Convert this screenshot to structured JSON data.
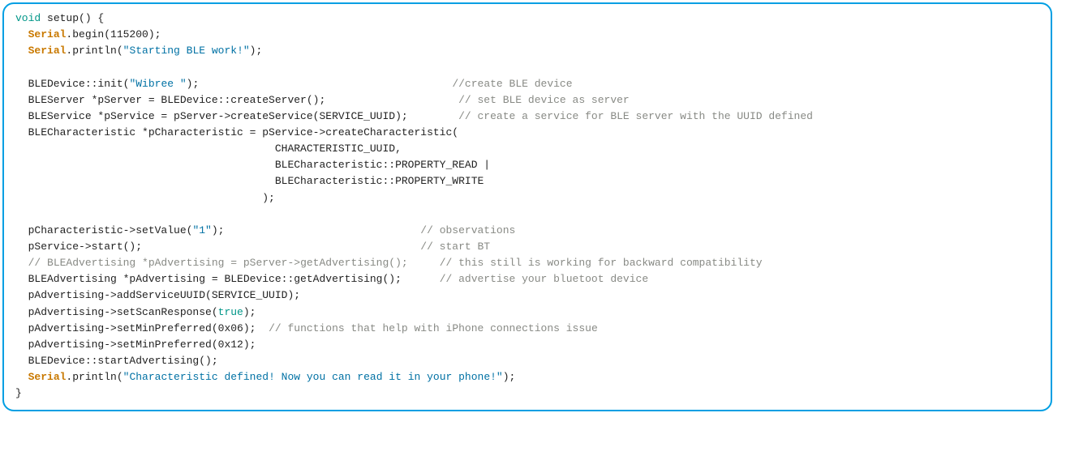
{
  "code": {
    "colors": {
      "border": "#009fe3",
      "keyword": "#009688",
      "type": "#c97900",
      "string": "#0071a4",
      "comment": "#888a85"
    },
    "tokens": [
      [
        [
          "kw",
          "void"
        ],
        [
          "plain",
          " setup"
        ],
        [
          "plain",
          "() {"
        ]
      ],
      [
        [
          "plain",
          "  "
        ],
        [
          "type",
          "Serial"
        ],
        [
          "plain",
          ".begin("
        ],
        [
          "plain",
          "115200"
        ],
        [
          "plain",
          ");"
        ]
      ],
      [
        [
          "plain",
          "  "
        ],
        [
          "type",
          "Serial"
        ],
        [
          "plain",
          ".println("
        ],
        [
          "str",
          "\"Starting BLE work!\""
        ],
        [
          "plain",
          ");"
        ]
      ],
      [
        [
          "plain",
          ""
        ]
      ],
      [
        [
          "plain",
          "  BLEDevice::init("
        ],
        [
          "str",
          "\"Wibree \""
        ],
        [
          "plain",
          ");                                        "
        ],
        [
          "com",
          "//create BLE device"
        ]
      ],
      [
        [
          "plain",
          "  BLEServer *pServer = BLEDevice::createServer();                     "
        ],
        [
          "com",
          "// set BLE device as server"
        ]
      ],
      [
        [
          "plain",
          "  BLEService *pService = pServer->createService(SERVICE_UUID);        "
        ],
        [
          "com",
          "// create a service for BLE server with the UUID defined"
        ]
      ],
      [
        [
          "plain",
          "  BLECharacteristic *pCharacteristic = pService->createCharacteristic("
        ]
      ],
      [
        [
          "plain",
          "                                         CHARACTERISTIC_UUID,"
        ]
      ],
      [
        [
          "plain",
          "                                         BLECharacteristic::PROPERTY_READ |"
        ]
      ],
      [
        [
          "plain",
          "                                         BLECharacteristic::PROPERTY_WRITE"
        ]
      ],
      [
        [
          "plain",
          "                                       );"
        ]
      ],
      [
        [
          "plain",
          ""
        ]
      ],
      [
        [
          "plain",
          "  pCharacteristic->setValue("
        ],
        [
          "str",
          "\"1\""
        ],
        [
          "plain",
          ");                               "
        ],
        [
          "com",
          "// observations"
        ]
      ],
      [
        [
          "plain",
          "  pService->start();                                            "
        ],
        [
          "com",
          "// start BT"
        ]
      ],
      [
        [
          "plain",
          "  "
        ],
        [
          "com",
          "// BLEAdvertising *pAdvertising = pServer->getAdvertising();     // this still is working for backward compatibility"
        ]
      ],
      [
        [
          "plain",
          "  BLEAdvertising *pAdvertising = BLEDevice::getAdvertising();      "
        ],
        [
          "com",
          "// advertise your bluetoot device"
        ]
      ],
      [
        [
          "plain",
          "  pAdvertising->addServiceUUID(SERVICE_UUID);"
        ]
      ],
      [
        [
          "plain",
          "  pAdvertising->setScanResponse("
        ],
        [
          "kw",
          "true"
        ],
        [
          "plain",
          ");"
        ]
      ],
      [
        [
          "plain",
          "  pAdvertising->setMinPreferred("
        ],
        [
          "plain",
          "0x06"
        ],
        [
          "plain",
          ");  "
        ],
        [
          "com",
          "// functions that help with iPhone connections issue"
        ]
      ],
      [
        [
          "plain",
          "  pAdvertising->setMinPreferred("
        ],
        [
          "plain",
          "0x12"
        ],
        [
          "plain",
          ");"
        ]
      ],
      [
        [
          "plain",
          "  BLEDevice::startAdvertising();"
        ]
      ],
      [
        [
          "plain",
          "  "
        ],
        [
          "type",
          "Serial"
        ],
        [
          "plain",
          ".println("
        ],
        [
          "str",
          "\"Characteristic defined! Now you can read it in your phone!\""
        ],
        [
          "plain",
          ");"
        ]
      ],
      [
        [
          "plain",
          "}"
        ]
      ]
    ]
  }
}
